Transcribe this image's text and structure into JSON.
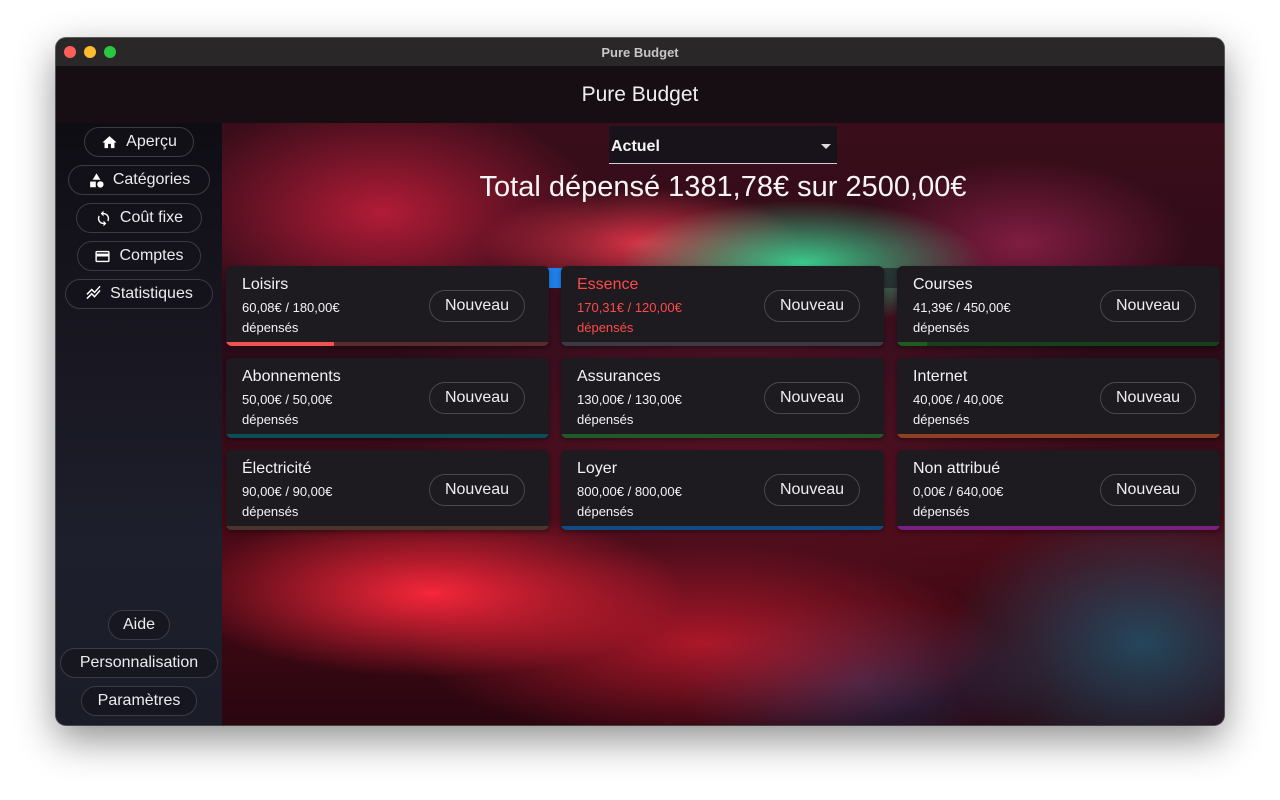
{
  "window": {
    "title": "Pure Budget"
  },
  "header": {
    "title": "Pure Budget"
  },
  "sidebar": {
    "top_items": [
      {
        "label": "Aperçu",
        "icon": "home-icon"
      },
      {
        "label": "Catégories",
        "icon": "shapes-icon"
      },
      {
        "label": "Coût fixe",
        "icon": "recurring-icon"
      },
      {
        "label": "Comptes",
        "icon": "wallet-icon"
      },
      {
        "label": "Statistiques",
        "icon": "chart-icon"
      }
    ],
    "bottom_items": [
      {
        "label": "Aide"
      },
      {
        "label": "Personnalisation"
      },
      {
        "label": "Paramètres"
      }
    ]
  },
  "main": {
    "period": {
      "selected": "Actuel"
    },
    "total_text": "Total dépensé 1381,78€ sur 2500,00€",
    "total_spent": 1381.78,
    "total_budget": 2500.0,
    "progress_segments": [
      {
        "amount": 60.08,
        "color": "#ef5350"
      },
      {
        "amount": 170.31,
        "color": "#5c6bc0"
      },
      {
        "amount": 41.39,
        "color": "#1b5e20"
      },
      {
        "amount": 50.0,
        "color": "#00838f"
      },
      {
        "amount": 130.0,
        "color": "#2e9b42"
      },
      {
        "amount": 40.0,
        "color": "#f4683c"
      },
      {
        "amount": 90.0,
        "color": "#6d4c41"
      },
      {
        "amount": 800.0,
        "color": "#1e7fe8"
      }
    ],
    "new_button_label": "Nouveau",
    "categories": [
      {
        "name": "Loisirs",
        "amount": "60,08€ / 180,00€",
        "spent_label": "dépensés",
        "over": false,
        "fraction": 0.334,
        "bar_color": "#ef5350",
        "track_color": "#5a2b2c"
      },
      {
        "name": "Essence",
        "amount": "170,31€ / 120,00€",
        "spent_label": "dépensés",
        "over": true,
        "fraction": 1.0,
        "bar_color": "#3b3944",
        "track_color": "#3b3944"
      },
      {
        "name": "Courses",
        "amount": "41,39€ / 450,00€",
        "spent_label": "dépensés",
        "over": false,
        "fraction": 0.092,
        "bar_color": "#1b5e20",
        "track_color": "#16401b"
      },
      {
        "name": "Abonnements",
        "amount": "50,00€ / 50,00€",
        "spent_label": "dépensés",
        "over": false,
        "fraction": 1.0,
        "bar_color": "#0a4e58",
        "track_color": "#0a4e58"
      },
      {
        "name": "Assurances",
        "amount": "130,00€ / 130,00€",
        "spent_label": "dépensés",
        "over": false,
        "fraction": 1.0,
        "bar_color": "#1f5a2a",
        "track_color": "#1f5a2a"
      },
      {
        "name": "Internet",
        "amount": "40,00€ / 40,00€",
        "spent_label": "dépensés",
        "over": false,
        "fraction": 1.0,
        "bar_color": "#8e3f26",
        "track_color": "#8e3f26"
      },
      {
        "name": "Électricité",
        "amount": "90,00€ / 90,00€",
        "spent_label": "dépensés",
        "over": false,
        "fraction": 1.0,
        "bar_color": "#4a342e",
        "track_color": "#4a342e"
      },
      {
        "name": "Loyer",
        "amount": "800,00€ / 800,00€",
        "spent_label": "dépensés",
        "over": false,
        "fraction": 1.0,
        "bar_color": "#114a84",
        "track_color": "#114a84"
      },
      {
        "name": "Non attribué",
        "amount": "0,00€ / 640,00€",
        "spent_label": "dépensés",
        "over": false,
        "fraction": 1.0,
        "bar_color": "#7a1f80",
        "track_color": "#7a1f80"
      }
    ]
  }
}
